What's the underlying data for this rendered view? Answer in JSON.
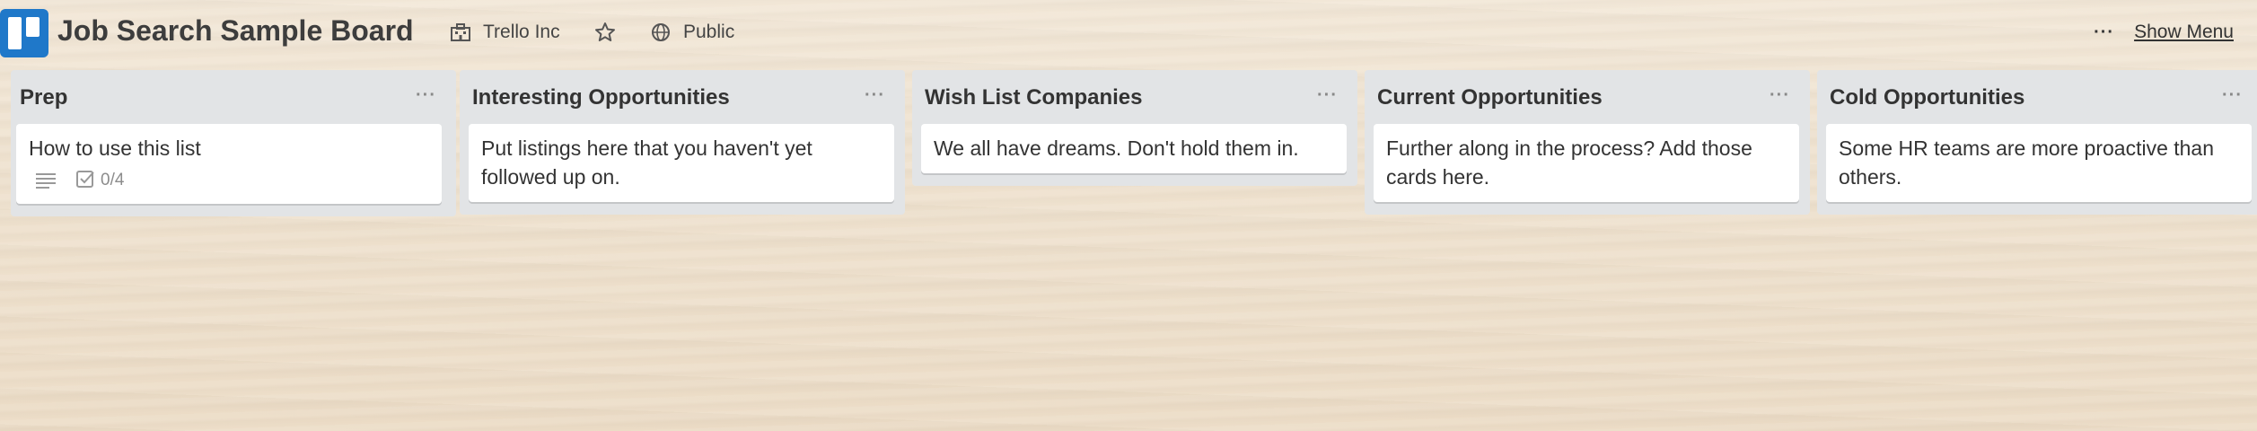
{
  "board": {
    "title": "Job Search Sample Board",
    "organization": "Trello Inc",
    "visibility": "Public",
    "show_menu_label": "Show Menu",
    "menu_dots": "···",
    "icons": {
      "logo": "trello-logo",
      "organization": "building-icon",
      "star": "star-icon",
      "visibility": "globe-icon"
    },
    "colors": {
      "logo_blue": "#1f78c9",
      "list_bg": "#e2e4e6",
      "card_bg": "#ffffff"
    }
  },
  "lists": [
    {
      "title": "Prep",
      "menu": "···",
      "card": {
        "text": "How to use this list",
        "has_description": true,
        "checklist": "0/4"
      }
    },
    {
      "title": "Interesting Opportunities",
      "menu": "···",
      "card": {
        "text": "Put listings here that you haven't yet followed up on."
      }
    },
    {
      "title": "Wish List Companies",
      "menu": "···",
      "card": {
        "text": "We all have dreams. Don't hold them in."
      }
    },
    {
      "title": "Current Opportunities",
      "menu": "···",
      "card": {
        "text": "Further along in the process? Add those cards here."
      }
    },
    {
      "title": "Cold Opportunities",
      "menu": "···",
      "card": {
        "text": "Some HR teams are more proactive than others."
      }
    }
  ]
}
